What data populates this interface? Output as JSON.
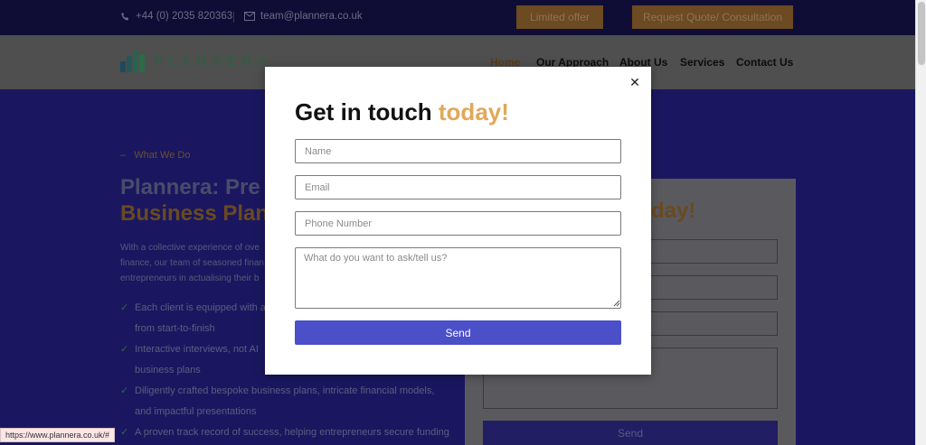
{
  "topbar": {
    "phone": "+44 (0) 2035 820363",
    "email": "team@plannera.co.uk",
    "limited_offer": "Limited offer",
    "request_quote": "Request Quote/ Consultation"
  },
  "brand": {
    "logo_text": "PLANNERA"
  },
  "nav": {
    "items": [
      "Home",
      "Our Approach",
      "About Us",
      "Services",
      "Contact Us"
    ]
  },
  "hero": {
    "kicker": "What We Do",
    "title_line1": "Plannera: Pre",
    "title_line2": "Business Plan",
    "paragraph": "With a collective experience of ove finance, our team of seasoned finan entrepreneurs in actualising their b",
    "bullets": [
      "Each client is equipped with a",
      "from start-to-finish",
      "Interactive interviews, not AI",
      "business plans",
      "Diligently crafted bespoke business plans, intricate financial models,",
      "and impactful presentations",
      "A proven track record of success, helping entrepreneurs secure funding"
    ]
  },
  "background_form": {
    "title_fragment": "day!",
    "send": "Send"
  },
  "modal": {
    "close_icon": "close-icon",
    "title_main": "Get in touch ",
    "title_accent": "today!",
    "accent_color": "#e3a757",
    "button_color": "#4b4fc8",
    "name_placeholder": "Name",
    "email_placeholder": "Email",
    "phone_placeholder": "Phone Number",
    "message_placeholder": "What do you want to ask/tell us?",
    "send_label": "Send"
  },
  "status_bar": {
    "url": "https://www.plannera.co.uk/#"
  }
}
